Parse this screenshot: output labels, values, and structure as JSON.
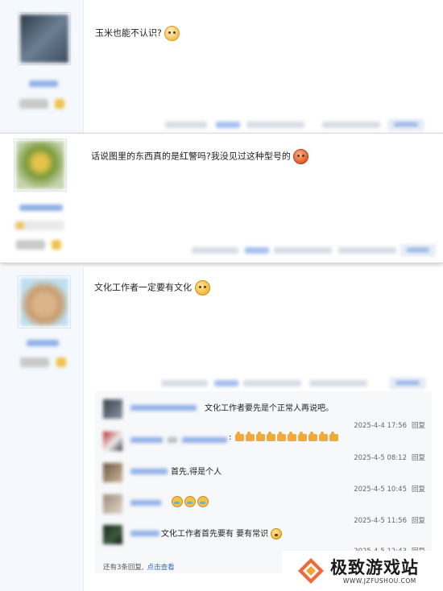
{
  "posts": [
    {
      "content": "玉米也能不认识?"
    },
    {
      "content": "话说图里的东西真的是红警吗?我没见过这种型号的"
    },
    {
      "content": "文化工作者一定要有文化"
    }
  ],
  "replies": [
    {
      "text": "文化工作者要先是个正常人再说吧。",
      "time": "2025-4-4 17:56",
      "action": "回复"
    },
    {
      "text": ":",
      "time": "2025-4-5 08:12",
      "action": "回复"
    },
    {
      "text": "首先,得是个人",
      "time": "2025-4-5 10:45",
      "action": "回复"
    },
    {
      "text": "",
      "time": "2025-4-5 11:56",
      "action": "回复"
    },
    {
      "text": "文化工作者首先要有 要有常识",
      "time": "2025-4-5 12:43",
      "action": "回复"
    }
  ],
  "more_replies": {
    "text": "还有3条回复,",
    "link": "点击查看"
  },
  "watermark": {
    "title": "极致游戏站",
    "url": "WWW.JZFUSHOU.COM"
  },
  "colors": {
    "link": "#3367d6",
    "side_bg": "#f5f8fc",
    "lzl_bg": "#f7f8fa"
  }
}
